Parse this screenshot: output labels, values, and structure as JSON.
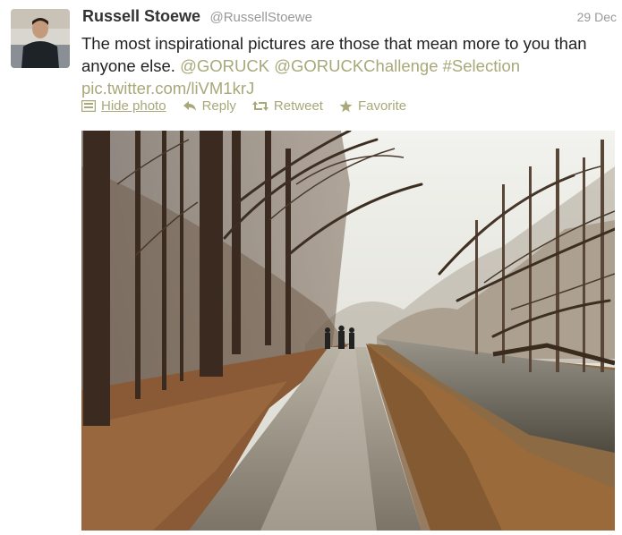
{
  "tweet": {
    "name": "Russell Stoewe",
    "handle": "@RussellStoewe",
    "date": "29 Dec",
    "text_plain": "The most inspirational pictures are those that mean more to you than anyone else.",
    "mention1": "@GORUCK",
    "mention2": "@GORUCKChallenge",
    "hashtag": "#Selection",
    "pic_link": "pic.twitter.com/liVM1krJ"
  },
  "actions": {
    "hide_photo": "Hide photo",
    "reply": "Reply",
    "retweet": "Retweet",
    "favorite": "Favorite"
  },
  "colors": {
    "link": "#a8a879",
    "text": "#222222",
    "meta": "#999999"
  },
  "icons": [
    "photo-icon",
    "reply-icon",
    "retweet-icon",
    "star-icon"
  ]
}
